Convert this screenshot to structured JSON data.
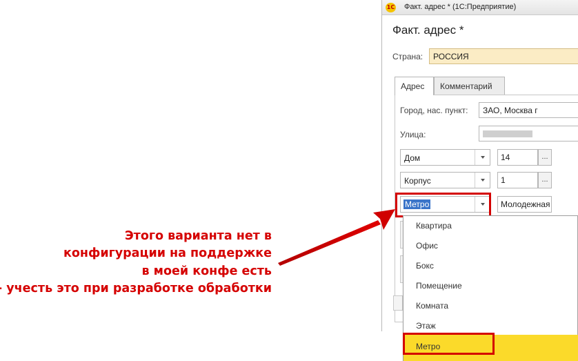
{
  "window": {
    "titlebar_logo": "1С",
    "titlebar_text": "Факт. адрес * (1С:Предприятие)"
  },
  "form": {
    "title": "Факт. адрес *",
    "country_label": "Страна:",
    "country_value": "РОССИЯ"
  },
  "tabs": [
    {
      "label": "Адрес",
      "active": true
    },
    {
      "label": "Комментарий",
      "active": false
    }
  ],
  "address": {
    "city_label": "Город, нас. пункт:",
    "city_value": "ЗАО, Москва г",
    "street_label": "Улица:",
    "street_value": "",
    "rows": [
      {
        "type": "Дом",
        "value": "14"
      },
      {
        "type": "Корпус",
        "value": "1"
      },
      {
        "type": "Метро",
        "value": "Молодежная"
      }
    ],
    "ellipsis": "..."
  },
  "dropdown": {
    "options": [
      "Квартира",
      "Офис",
      "Бокс",
      "Помещение",
      "Комната",
      "Этаж",
      "Метро"
    ],
    "selected": "Метро"
  },
  "annotation": {
    "lines": [
      "Этого варианта нет в",
      "конфигурации на поддержке",
      "в моей конфе есть",
      "- учесть это при разработке обработки"
    ],
    "color": "#d50000"
  },
  "colors": {
    "highlight": "#d40000",
    "selected_item": "#fbda2a",
    "country_field": "#fbecc5"
  }
}
